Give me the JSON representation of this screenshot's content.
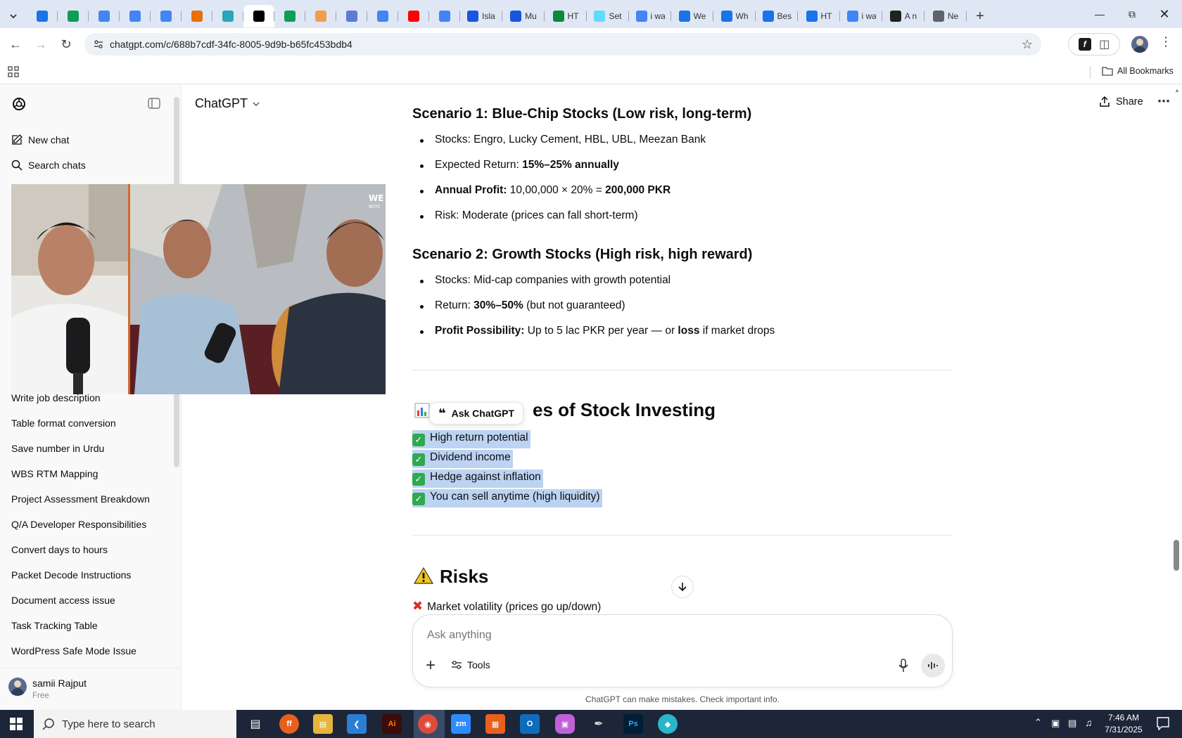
{
  "browser": {
    "tabs": [
      {
        "title": "",
        "color": "#1a73e8"
      },
      {
        "title": "",
        "color": "#0f9d58"
      },
      {
        "title": "",
        "color": "#4285f4"
      },
      {
        "title": "",
        "color": "#4285f4"
      },
      {
        "title": "",
        "color": "#4285f4"
      },
      {
        "title": "",
        "color": "#e8710a"
      },
      {
        "title": "",
        "color": "#2aa6b8"
      },
      {
        "title": "",
        "color": "#000000",
        "active": true
      },
      {
        "title": "",
        "color": "#0f9d58"
      },
      {
        "title": "",
        "color": "#f0a04b"
      },
      {
        "title": "",
        "color": "#5b7bd5"
      },
      {
        "title": "",
        "color": "#4285f4"
      },
      {
        "title": "",
        "color": "#ff0000"
      },
      {
        "title": "",
        "color": "#4285f4"
      },
      {
        "title": "Isla",
        "color": "#1a56db"
      },
      {
        "title": "Mu",
        "color": "#1a56db"
      },
      {
        "title": "HT",
        "color": "#0b8a3d"
      },
      {
        "title": "Set",
        "color": "#61dafb"
      },
      {
        "title": "i wa",
        "color": "#4285f4"
      },
      {
        "title": "We",
        "color": "#1a73e8"
      },
      {
        "title": "Wh",
        "color": "#1a73e8"
      },
      {
        "title": "Bes",
        "color": "#1a73e8"
      },
      {
        "title": "HT",
        "color": "#1a73e8"
      },
      {
        "title": "i wa",
        "color": "#4285f4"
      },
      {
        "title": "A n",
        "color": "#222222"
      },
      {
        "title": "Ne",
        "color": "#5f6368"
      }
    ],
    "url": "chatgpt.com/c/688b7cdf-34fc-8005-9d9b-b65fc453bdb4",
    "all_bookmarks": "All Bookmarks"
  },
  "sidebar": {
    "new_chat": "New chat",
    "search_chats": "Search chats",
    "history": [
      "Write job description",
      "Table format conversion",
      "Save number in Urdu",
      "WBS RTM Mapping",
      "Project Assessment Breakdown",
      "Q/A Developer Responsibilities",
      "Convert days to hours",
      "Packet Decode Instructions",
      "Document access issue",
      "Task Tracking Table",
      "WordPress Safe Mode Issue"
    ],
    "user_name": "samii Rajput",
    "user_plan": "Free"
  },
  "header": {
    "model": "ChatGPT",
    "share": "Share"
  },
  "content": {
    "scenario1": {
      "title": "Scenario 1: Blue-Chip Stocks (Low risk, long-term)",
      "items": [
        {
          "label": "Stocks: Engro, Lucky Cement, HBL, UBL, Meezan Bank"
        },
        {
          "prefix": "Expected Return: ",
          "bold": "15%–25% annually"
        },
        {
          "bold_prefix": "Annual Profit:",
          "text": " 10,00,000 × 20% = ",
          "bold": "200,000 PKR"
        },
        {
          "label": "Risk: Moderate (prices can fall short-term)"
        }
      ]
    },
    "scenario2": {
      "title": "Scenario 2: Growth Stocks (High risk, high reward)",
      "items": [
        {
          "label": "Stocks: Mid-cap companies with growth potential"
        },
        {
          "prefix": "Return: ",
          "bold": "30%–50%",
          "suffix": " (but not guaranteed)"
        },
        {
          "bold_prefix": "Profit Possibility:",
          "text": " Up to 5 lac PKR per year — or ",
          "bold": "loss",
          "suffix": " if market drops"
        }
      ]
    },
    "advantages": {
      "title_visible": "es of Stock Investing",
      "ask_chatgpt": "Ask ChatGPT",
      "items": [
        "High return potential",
        "Dividend income",
        "Hedge against inflation",
        "You can sell anytime (high liquidity)"
      ]
    },
    "risks": {
      "title": "Risks",
      "items": [
        "Market volatility (prices go up/down)"
      ]
    }
  },
  "composer": {
    "placeholder": "Ask anything",
    "tools": "Tools",
    "disclaimer": "ChatGPT can make mistakes. Check important info."
  },
  "taskbar": {
    "search_placeholder": "Type here to search",
    "time": "7:46 AM",
    "date": "7/31/2025"
  }
}
